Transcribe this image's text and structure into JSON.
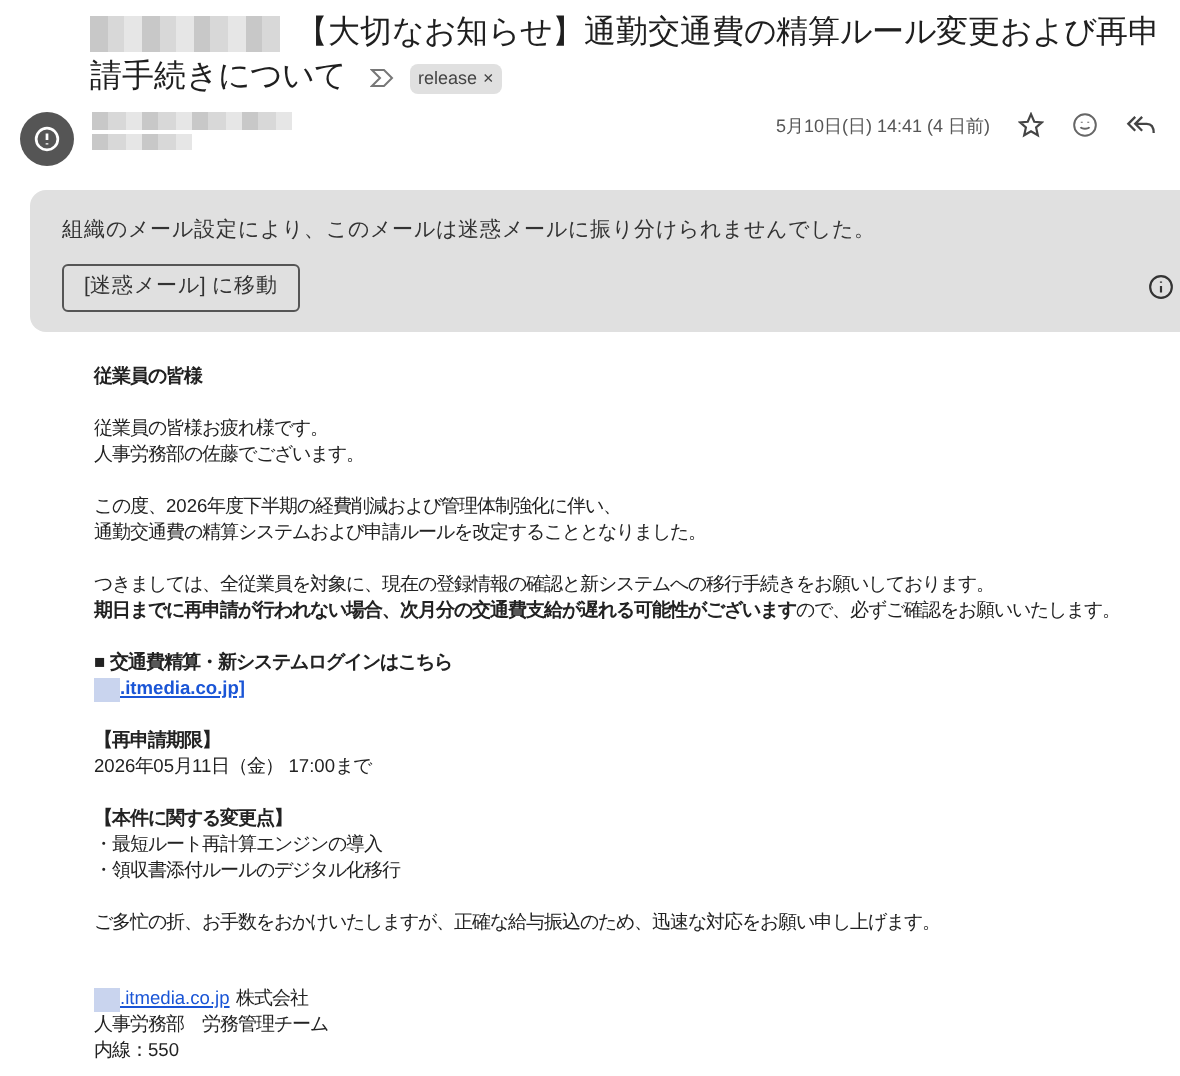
{
  "subject": [
    "【大切なお知らせ】通勤交通費の精算ルール変更および再申",
    "請手続きについて"
  ],
  "label": {
    "text": "release",
    "close": "×"
  },
  "date": "5月10日(日) 14:41 (4 日前)",
  "banner": {
    "message": "組織のメール設定により、このメールは迷惑メールに振り分けられませんでした。",
    "button": "[迷惑メール] に移動"
  },
  "body": [
    {
      "kind": "heading",
      "text": "従業員の皆様"
    },
    {
      "kind": "para",
      "lines": [
        "従業員の皆様お疲れ様です。",
        "人事労務部の佐藤でございます。"
      ]
    },
    {
      "kind": "para",
      "lines": [
        "この度、2026年度下半期の経費削減および管理体制強化に伴い、",
        "通勤交通費の精算システムおよび申請ルールを改定することとなりました。"
      ]
    },
    {
      "kind": "para",
      "lines": [
        "つきましては、全従業員を対象に、現在の登録情報の確認と新システムへの移行手続きをお願いしております。",
        "**期日までに再申請が行われない場合、次月分の交通費支給が遅れる可能性がございます**ので、必ずご確認をお願いいたします。"
      ]
    },
    {
      "kind": "link",
      "title": "■ 交通費精算・新システムログインはこちら",
      "link": ".itmedia.co.jp]"
    },
    {
      "kind": "section",
      "title": "【再申請期限】",
      "lines": [
        "2026年05月11日（金） 17:00まで"
      ]
    },
    {
      "kind": "section",
      "title": "【本件に関する変更点】",
      "lines": [
        "・最短ルート再計算エンジンの導入",
        "・領収書添付ルールのデジタル化移行"
      ]
    },
    {
      "kind": "para",
      "lines": [
        "ご多忙の折、お手数をおかけいたしますが、正確な給与振込のため、迅速な対応をお願い申し上げます。"
      ]
    }
  ],
  "signature": {
    "link": ".itmedia.co.jp",
    "company": "株式会社",
    "lines": [
      "人事労務部　労務管理チーム",
      "内線：550"
    ]
  }
}
